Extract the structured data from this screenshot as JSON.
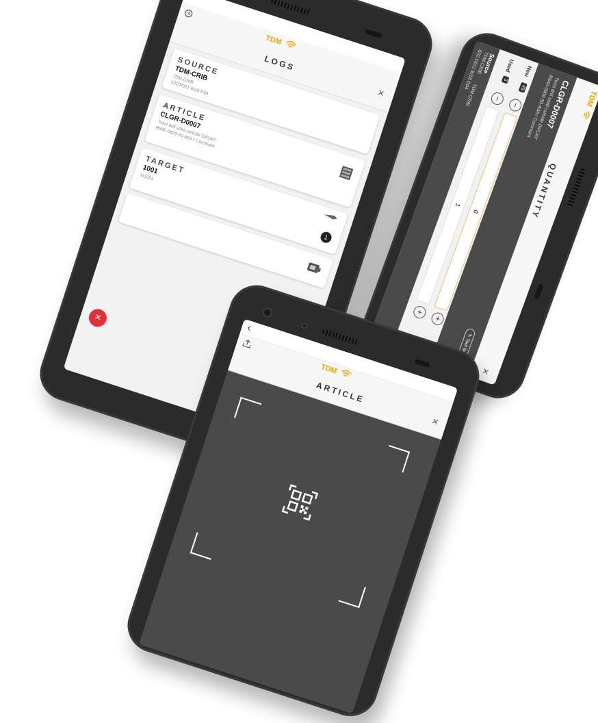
{
  "logs_screen": {
    "brand": "TDM",
    "title": "LOGS",
    "close": "×",
    "back": "‹",
    "cards": [
      {
        "label": "SOURCE",
        "main": "TDM-CRIB",
        "sub1": "TDM-CRIB",
        "sub2": "S02 D011 W18 D04"
      },
      {
        "label": "ARTICLE",
        "main": "CLGR-D0007",
        "sub1": "Twist drill solid carbide Dil/140°",
        "sub2": "R840-0800-50-A0A / Coromant"
      },
      {
        "label": "TARGET",
        "main": "1001",
        "sub1": "M1001",
        "badge": "1"
      }
    ],
    "fab_close": "×",
    "fab_swap": "⇄"
  },
  "quantity_screen": {
    "brand": "TDM",
    "title": "QUANTITY",
    "close": "×",
    "article_code": "CLGR-D0007",
    "article_desc1": "Twist drill solid carbide Dil/140°",
    "article_desc2": "R840-0800-50-A0A / Coromant",
    "tool_item_button": "Tool Item",
    "new_label": "New",
    "new_count": "49",
    "used_label": "Used",
    "used_count": "3",
    "new_quantity": "0",
    "used_quantity": "1",
    "plus": "+",
    "minus": "−",
    "source_label": "Source",
    "source_name": "TDM-CRIB",
    "source_sub1": "TDM-CRIB",
    "source_sub2": "S02 D011 W18 D04"
  },
  "article_screen": {
    "brand": "TDM",
    "title": "ARTICLE",
    "close": "×",
    "back": "‹"
  },
  "colors": {
    "accent": "#f0a400",
    "fab_red": "#e0313f",
    "dark_panel": "#4a4a4a"
  }
}
